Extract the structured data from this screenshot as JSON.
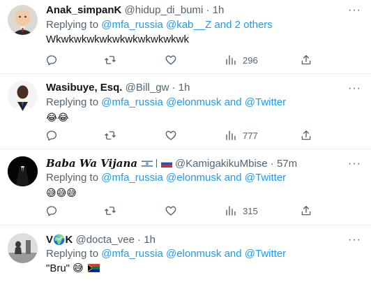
{
  "tweets": [
    {
      "name": "Anak_simpanK",
      "handle": "@hidup_di_bumi",
      "sep": "·",
      "time": "1h",
      "replying_prefix": "Replying to ",
      "mentions": "@mfa_russia @kab__Z and 2 others",
      "text": "Wkwkwkwkwkwkwkwkwkwkwk",
      "views": "296"
    },
    {
      "name": "Wasibuye, Esq.",
      "handle": "@Bill_gw",
      "sep": "·",
      "time": "1h",
      "replying_prefix": "Replying to ",
      "mentions": "@mfa_russia @elonmusk and @Twitter",
      "text": "😂😂",
      "views": "777"
    },
    {
      "name": "Baba Wa Vijana",
      "handle": "@KamigakikuMbise",
      "sep": "·",
      "time": "57m",
      "replying_prefix": "Replying to ",
      "mentions": "@mfa_russia @elonmusk and @Twitter",
      "text": "😅😅😅",
      "views": "315"
    },
    {
      "name_prefix": "V",
      "name_emoji": "🌍",
      "name_suffix": "K",
      "handle": "@docta_vee",
      "sep": "·",
      "time": "1h",
      "replying_prefix": "Replying to ",
      "mentions": "@mfa_russia @elonmusk and @Twitter",
      "text": "\"Bru\" 😅"
    }
  ],
  "icons": {
    "more": "more-icon",
    "reply": "reply-icon",
    "retweet": "retweet-icon",
    "like": "like-icon",
    "views": "views-icon",
    "share": "share-icon"
  },
  "colors": {
    "link": "#1d9bf0",
    "secondary_text": "#536471",
    "divider": "#eff3f4"
  }
}
